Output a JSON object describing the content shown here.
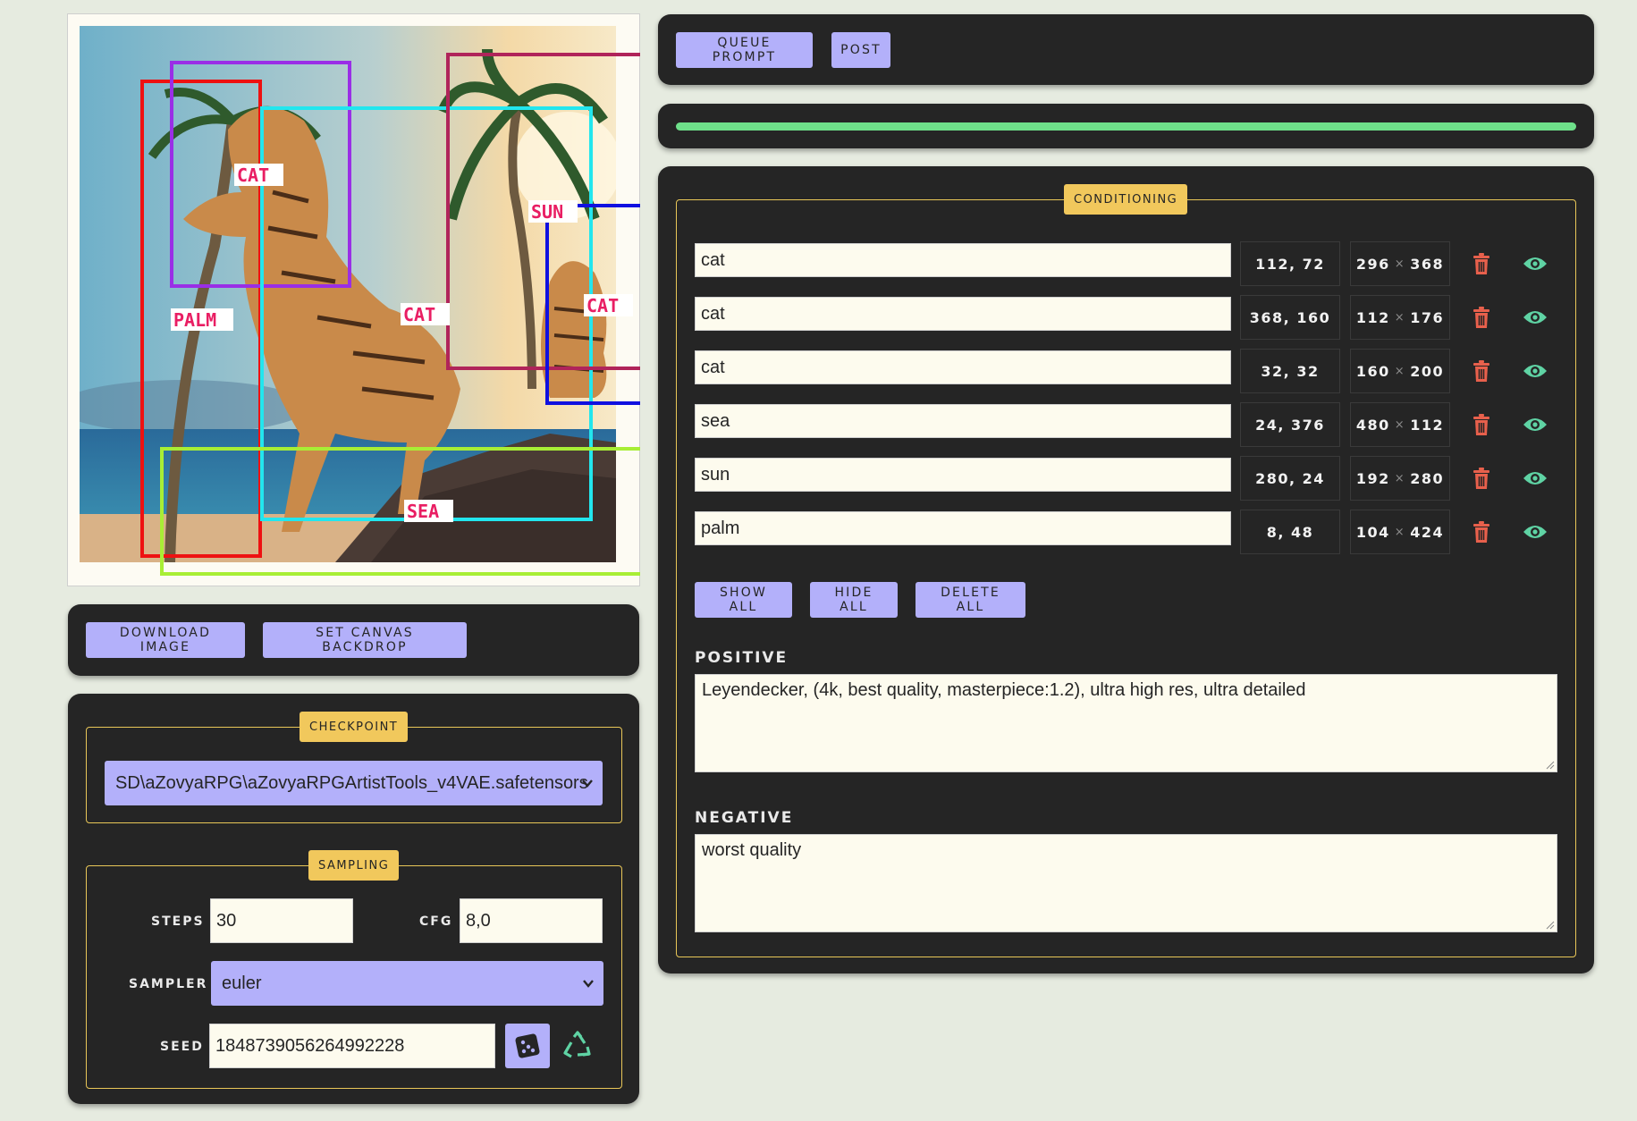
{
  "image_panel": {
    "labels": {
      "cat": "CAT",
      "sun": "SUN",
      "palm": "PALM",
      "sea": "SEA"
    },
    "region_colors": {
      "palm": "#ee1111",
      "cat_1": "#9a2ee6",
      "cat_2": "#22e6ee",
      "cat_3": "#b0245a",
      "sun": "#1010e0",
      "sea": "#a8ee35"
    }
  },
  "image_actions": {
    "download_label": "DOWNLOAD IMAGE",
    "backdrop_label": "SET CANVAS BACKDROP"
  },
  "checkpoint": {
    "legend": "CHECKPOINT",
    "value": "SD\\aZovyaRPG\\aZovyaRPGArtistTools_v4VAE.safetensors"
  },
  "sampling": {
    "legend": "SAMPLING",
    "steps_label": "STEPS",
    "steps_value": "30",
    "cfg_label": "CFG",
    "cfg_value": "8,0",
    "sampler_label": "SAMPLER",
    "sampler_value": "euler",
    "seed_label": "SEED",
    "seed_value": "1848739056264992228"
  },
  "toolbar": {
    "queue_label": "QUEUE PROMPT",
    "post_label": "POST"
  },
  "progress": {
    "value": 1.0,
    "color": "#6ee08a"
  },
  "conditioning": {
    "legend": "CONDITIONING",
    "regions": [
      {
        "prompt": "cat",
        "pos": "112, 72",
        "w": "296",
        "h": "368"
      },
      {
        "prompt": "cat",
        "pos": "368, 160",
        "w": "112",
        "h": "176"
      },
      {
        "prompt": "cat",
        "pos": "32, 32",
        "w": "160",
        "h": "200"
      },
      {
        "prompt": "sea",
        "pos": "24, 376",
        "w": "480",
        "h": "112"
      },
      {
        "prompt": "sun",
        "pos": "280, 24",
        "w": "192",
        "h": "280"
      },
      {
        "prompt": "palm",
        "pos": "8, 48",
        "w": "104",
        "h": "424"
      }
    ],
    "size_separator": "×",
    "show_all_label": "SHOW ALL",
    "hide_all_label": "HIDE ALL",
    "delete_all_label": "DELETE ALL",
    "positive_label": "POSITIVE",
    "positive_value": "Leyendecker, (4k, best quality, masterpiece:1.2), ultra high res, ultra detailed",
    "negative_label": "NEGATIVE",
    "negative_value": "worst quality"
  },
  "colors": {
    "panel": "#252525",
    "accent_button": "#b3b0fa",
    "legend": "#f1c85c",
    "trash": "#e8604c",
    "eye": "#5fd3a4",
    "recycle": "#5fd3a4"
  }
}
